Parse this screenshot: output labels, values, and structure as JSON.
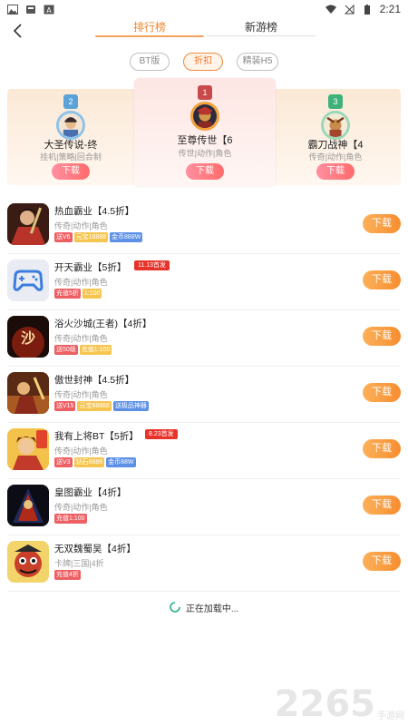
{
  "status_bar": {
    "time": "2:21",
    "left_icons": [
      "image-icon",
      "app-icon",
      "a-box-icon"
    ],
    "right_icons": [
      "wifi-icon",
      "no-signal-icon",
      "battery-icon"
    ]
  },
  "nav": {
    "tabs": [
      {
        "label": "排行榜",
        "active": true
      },
      {
        "label": "新游榜",
        "active": false
      }
    ]
  },
  "filters": [
    {
      "label": "BT版",
      "active": false
    },
    {
      "label": "折扣",
      "active": true
    },
    {
      "label": "精装H5",
      "active": false
    }
  ],
  "podium": [
    {
      "rank": "2",
      "name": "大圣传说-终",
      "sub": "挂机|策略|回合制",
      "download": "下载",
      "color": "#5aa3d9"
    },
    {
      "rank": "1",
      "name": "至尊传世【6",
      "sub": "传世|动作|角色",
      "download": "下载",
      "color": "#c84a4a"
    },
    {
      "rank": "3",
      "name": "霸刀战神【4",
      "sub": "传奇|动作|角色",
      "download": "下载",
      "color": "#3fb27a"
    }
  ],
  "games": [
    {
      "title": "热血霸业【4.5折】",
      "badge": "",
      "category": "传奇|动作|角色",
      "tags": [
        {
          "text": "送V6",
          "color": "red"
        },
        {
          "text": "元宝18888",
          "color": "yellow"
        },
        {
          "text": "金币888W",
          "color": "blue"
        }
      ],
      "download": "下载",
      "icon": "warrior-portrait-icon"
    },
    {
      "title": "开天霸业【5折】",
      "badge": "11.13首发",
      "category": "传奇|动作|角色",
      "tags": [
        {
          "text": "充值5折",
          "color": "red"
        },
        {
          "text": "1:100",
          "color": "yellow"
        }
      ],
      "download": "下载",
      "icon": "gamepad-icon"
    },
    {
      "title": "浴火沙城(王者)【4折】",
      "badge": "",
      "category": "传奇|动作|角色",
      "tags": [
        {
          "text": "送50级",
          "color": "red"
        },
        {
          "text": "充值1:100",
          "color": "yellow"
        }
      ],
      "download": "下载",
      "icon": "sand-city-icon"
    },
    {
      "title": "傲世封神【4.5折】",
      "badge": "",
      "category": "传奇|动作|角色",
      "tags": [
        {
          "text": "送V15",
          "color": "red"
        },
        {
          "text": "元宝88888",
          "color": "yellow"
        },
        {
          "text": "送极品神器",
          "color": "blue"
        }
      ],
      "download": "下载",
      "icon": "battle-scene-icon"
    },
    {
      "title": "我有上将BT【5折】",
      "badge": "8.23首发",
      "category": "传奇|动作|角色",
      "tags": [
        {
          "text": "送V3",
          "color": "red"
        },
        {
          "text": "钻石8888",
          "color": "yellow"
        },
        {
          "text": "金币88W",
          "color": "blue"
        }
      ],
      "download": "下载",
      "icon": "general-portrait-icon"
    },
    {
      "title": "皇图霸业【4折】",
      "badge": "",
      "category": "传奇|动作|角色",
      "tags": [
        {
          "text": "充值1:100",
          "color": "red"
        }
      ],
      "download": "下载",
      "icon": "dark-warrior-icon"
    },
    {
      "title": "无双魏蜀吴【4折】",
      "badge": "",
      "category": "卡牌|三国|4折",
      "tags": [
        {
          "text": "充值4折",
          "color": "red"
        }
      ],
      "download": "下载",
      "icon": "cartoon-general-icon"
    }
  ],
  "loading_text": "正在加载中...",
  "watermark": {
    "number": "2265",
    "text": "手游网"
  }
}
